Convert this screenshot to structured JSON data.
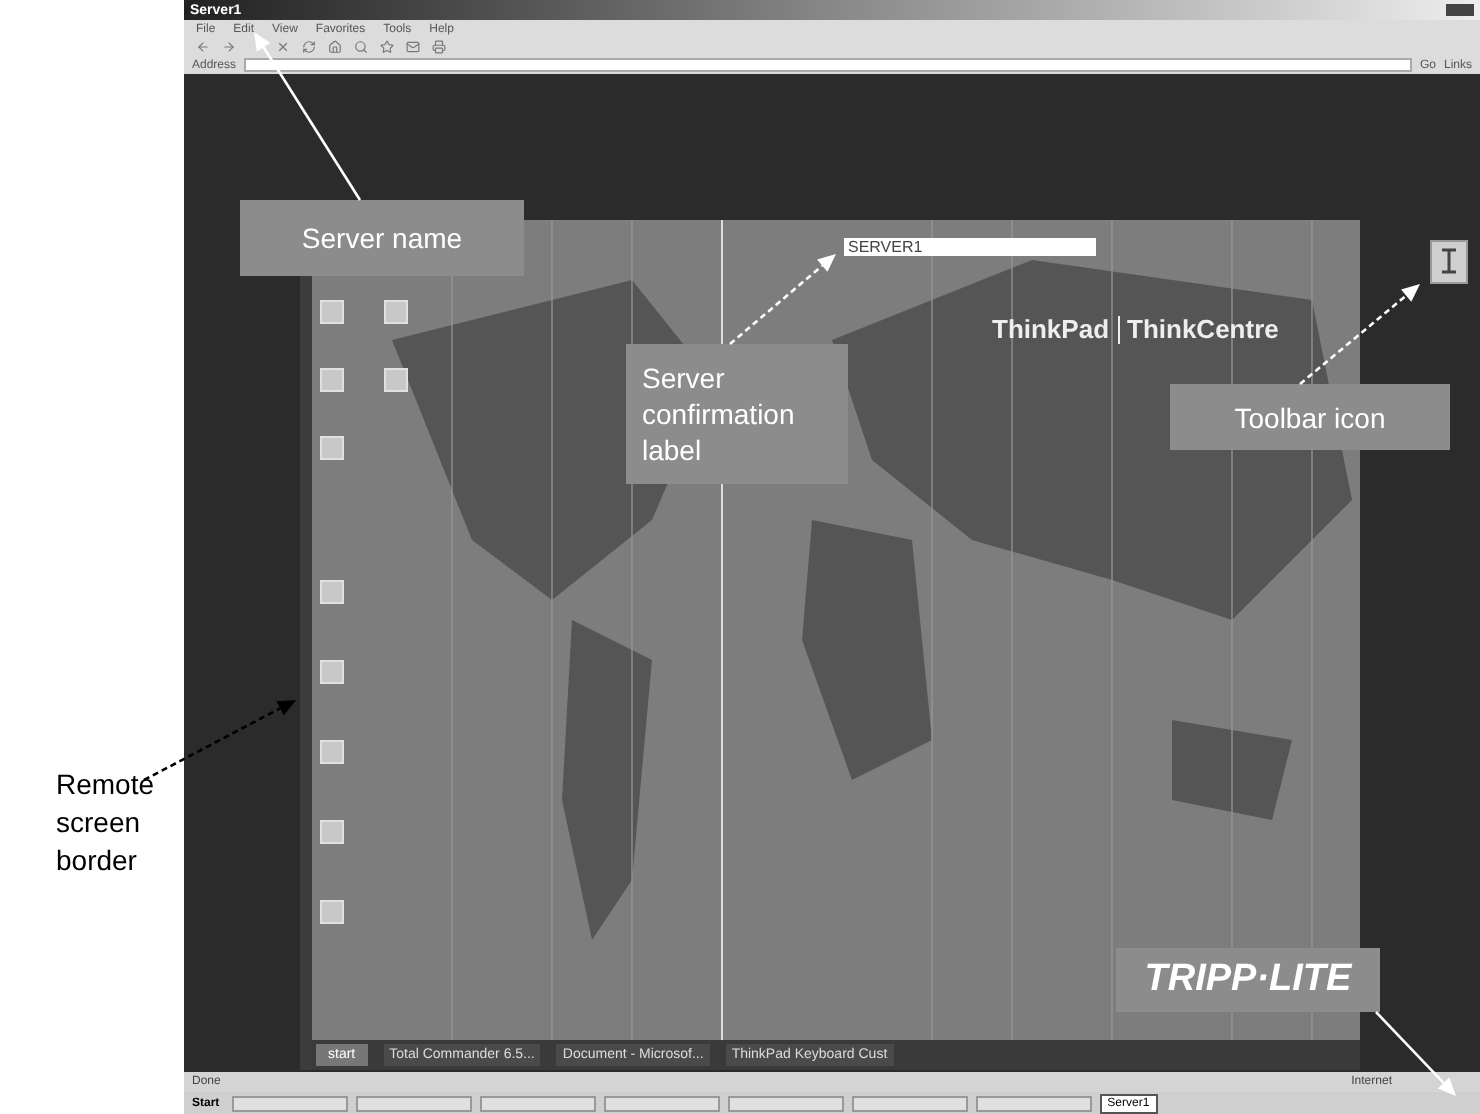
{
  "browser": {
    "title": "Server1",
    "menu": [
      "File",
      "Edit",
      "View",
      "Favorites",
      "Tools",
      "Help"
    ],
    "address_label": "Address",
    "go": "Go",
    "links": "Links",
    "status": "Done",
    "zone": "Internet"
  },
  "remote": {
    "server_label": "SERVER1",
    "brand": [
      "ThinkPad",
      "ThinkCentre"
    ],
    "start": "start",
    "tasks": [
      "Total Commander 6.5...",
      "Document - Microsof...",
      "ThinkPad Keyboard Cust"
    ]
  },
  "taskbar": {
    "start": "Start",
    "active_window": "Server1"
  },
  "logo": "TRIPP·LITE",
  "annotations": [
    {
      "kind": "box",
      "text": "Server name"
    },
    {
      "kind": "box",
      "text": "Server confirmation label"
    },
    {
      "kind": "box",
      "text": "Toolbar icon"
    },
    {
      "kind": "plain",
      "text": "Remote screen border"
    },
    {
      "kind": "arrow-only"
    }
  ]
}
